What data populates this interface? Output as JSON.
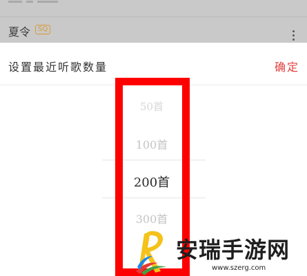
{
  "background_list": {
    "song_title": "夏令",
    "quality_badge": "SQ"
  },
  "dialog": {
    "title": "设置最近听歌数量",
    "confirm_label": "确定"
  },
  "picker": {
    "options": [
      "50首",
      "100首",
      "200首",
      "300首"
    ],
    "selected": "200首"
  },
  "watermark": {
    "name": "安瑞手游网",
    "url": "www.szerg.com"
  },
  "colors": {
    "accent": "#e0403f",
    "highlight": "#ff0000",
    "badge": "#d89a34"
  }
}
